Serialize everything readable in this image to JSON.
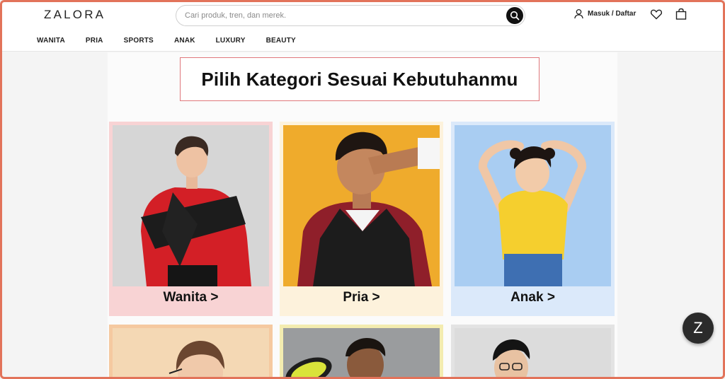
{
  "brand": {
    "logo": "ZALORA"
  },
  "search": {
    "placeholder": "Cari produk, tren, dan merek."
  },
  "account": {
    "label": "Masuk / Daftar"
  },
  "nav": {
    "items": [
      "WANITA",
      "PRIA",
      "SPORTS",
      "ANAK",
      "LUXURY",
      "BEAUTY"
    ]
  },
  "main": {
    "heading": "Pilih Kategori Sesuai Kebutuhanmu",
    "categories": [
      {
        "label": "Wanita >",
        "card_color": "#f8d3d4",
        "photo_bg": "#d9d9d9"
      },
      {
        "label": "Pria >",
        "card_color": "#fdf2dc",
        "photo_bg": "#f0ab2a"
      },
      {
        "label": "Anak >",
        "card_color": "#dbe9fa",
        "photo_bg": "#a8cdf2"
      }
    ],
    "more_categories": [
      {
        "card_color": "#f5c9a0",
        "photo_bg": "#f3d8b6"
      },
      {
        "card_color": "#f3ecb0",
        "photo_bg": "#9a9c9e"
      },
      {
        "card_color": "#e3e3e3",
        "photo_bg": "#dcdcdc"
      }
    ]
  },
  "chat": {
    "label": "Z"
  },
  "icons": [
    "search-icon",
    "user-icon",
    "heart-icon",
    "bag-icon"
  ]
}
